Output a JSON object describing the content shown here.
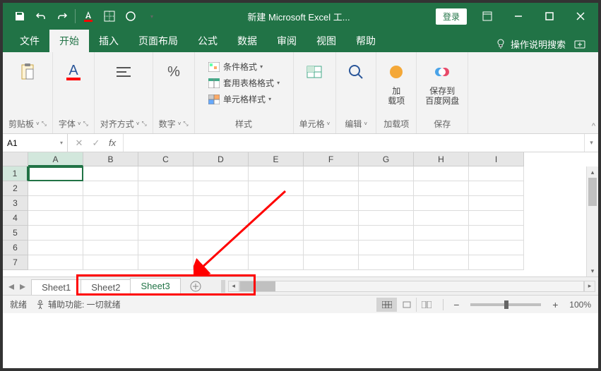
{
  "title": "新建 Microsoft Excel 工...",
  "login": "登录",
  "tabs": {
    "file": "文件",
    "home": "开始",
    "insert": "插入",
    "layout": "页面布局",
    "formulas": "公式",
    "data": "数据",
    "review": "审阅",
    "view": "视图",
    "help": "帮助"
  },
  "tell_me": "操作说明搜索",
  "ribbon": {
    "clipboard": "剪贴板",
    "font": "字体",
    "align": "对齐方式",
    "number": "数字",
    "styles_label": "样式",
    "cond_format": "条件格式",
    "table_format": "套用表格格式",
    "cell_styles": "单元格样式",
    "cells": "单元格",
    "editing": "编辑",
    "addins": "加载项",
    "addins_label": "加\n载项",
    "save_cloud": "保存到\n百度网盘",
    "save_label": "保存"
  },
  "name_box": "A1",
  "columns": [
    "A",
    "B",
    "C",
    "D",
    "E",
    "F",
    "G",
    "H",
    "I"
  ],
  "rows": [
    "1",
    "2",
    "3",
    "4",
    "5",
    "6",
    "7"
  ],
  "sheets": [
    "Sheet1",
    "Sheet2",
    "Sheet3"
  ],
  "active_sheet": 2,
  "status": {
    "ready": "就绪",
    "accessibility_label": "辅助功能: 一切就绪",
    "zoom": "100%"
  },
  "colors": {
    "primary": "#217346",
    "annotation": "#ff0000"
  }
}
